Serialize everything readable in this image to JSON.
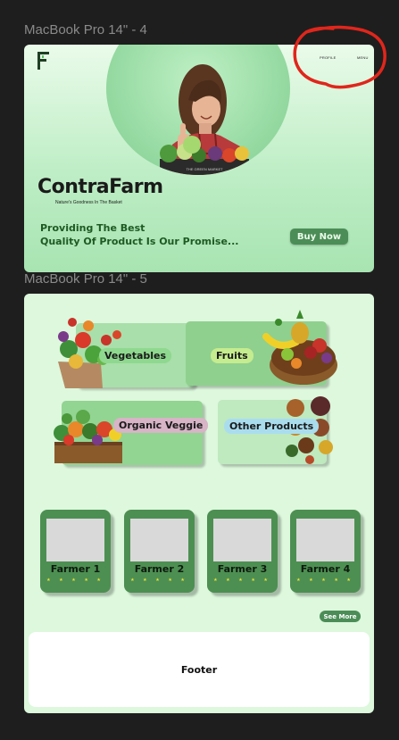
{
  "frames": {
    "frame1_label": "MacBook Pro 14\" - 4",
    "frame2_label": "MacBook Pro 14\" - 5"
  },
  "hero": {
    "logo_letter": "F",
    "nav": [
      "PROFILE",
      "MENU"
    ],
    "brand": "ContraFarm",
    "tagline": "Nature's Goodness In The Basket",
    "promise_line1": "Providing The Best",
    "promise_line2": "Quality Of Product Is Our Promise...",
    "buy_button": "Buy Now",
    "crate_text": "THE GREEN MARKET"
  },
  "categories": [
    {
      "label": "Vegetables"
    },
    {
      "label": "Fruits"
    },
    {
      "label": "Organic Veggie"
    },
    {
      "label": "Other Products"
    }
  ],
  "farmers": [
    {
      "name": "Farmer 1",
      "rating": 5
    },
    {
      "name": "Farmer 2",
      "rating": 5
    },
    {
      "name": "Farmer 3",
      "rating": 5
    },
    {
      "name": "Farmer 4",
      "rating": 5
    }
  ],
  "stars_glyph": "★ ★ ★ ★ ★",
  "see_more": "See More",
  "footer": "Footer",
  "colors": {
    "canvas": "#1e1e1e",
    "brand_green": "#4c8d57",
    "hero_bg": "#bfeec6",
    "section_bg": "#ddf8dd",
    "annotation": "#e0261c"
  }
}
